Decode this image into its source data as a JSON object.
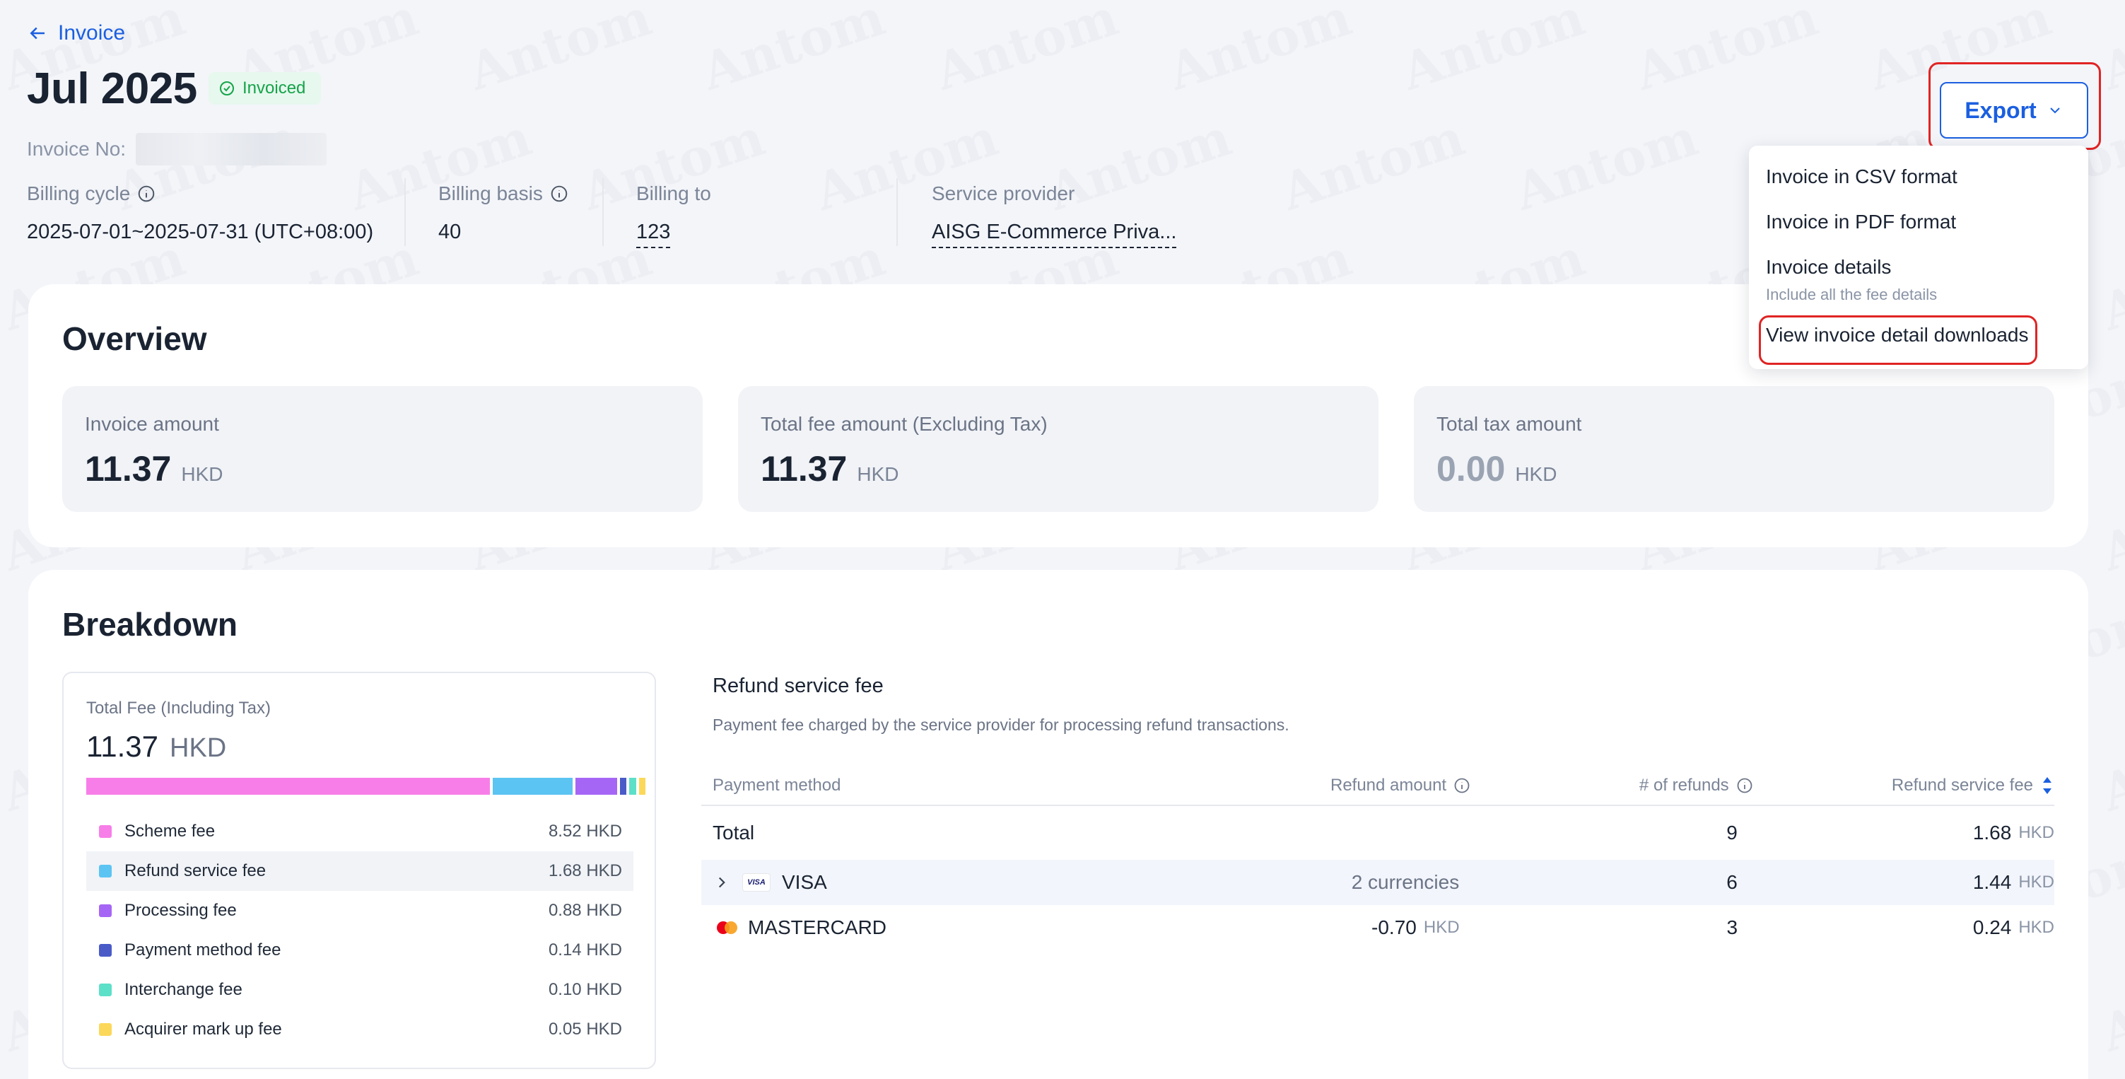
{
  "header": {
    "back_label": "Invoice",
    "title": "Jul 2025",
    "status": "Invoiced",
    "invoice_no_label": "Invoice No:"
  },
  "meta": {
    "billing_cycle_label": "Billing cycle",
    "billing_cycle_value": "2025-07-01~2025-07-31 (UTC+08:00)",
    "billing_basis_label": "Billing basis",
    "billing_basis_value": "40",
    "billing_to_label": "Billing to",
    "billing_to_value": "123",
    "service_provider_label": "Service provider",
    "service_provider_value": "AISG E-Commerce Priva..."
  },
  "export": {
    "label": "Export",
    "menu": {
      "csv": "Invoice in CSV format",
      "pdf": "Invoice in PDF format",
      "details": "Invoice details",
      "details_sub": "Include all the fee details",
      "downloads": "View invoice detail downloads"
    }
  },
  "overview": {
    "title": "Overview",
    "invoice_amount_label": "Invoice amount",
    "invoice_amount": "11.37",
    "total_fee_label": "Total fee amount (Excluding Tax)",
    "total_fee": "11.37",
    "total_tax_label": "Total tax amount",
    "total_tax": "0.00",
    "currency": "HKD"
  },
  "breakdown": {
    "title": "Breakdown",
    "total_fee_label": "Total Fee (Including Tax)",
    "total_fee_value": "11.37",
    "total_fee_currency": "HKD",
    "fees": [
      {
        "name": "Scheme fee",
        "amount": "8.52 HKD",
        "value": 8.52,
        "color": "#f77ee8"
      },
      {
        "name": "Refund service fee",
        "amount": "1.68 HKD",
        "value": 1.68,
        "color": "#5cc4f2"
      },
      {
        "name": "Processing fee",
        "amount": "0.88 HKD",
        "value": 0.88,
        "color": "#a666f5"
      },
      {
        "name": "Payment method fee",
        "amount": "0.14 HKD",
        "value": 0.14,
        "color": "#4a5bc8"
      },
      {
        "name": "Interchange fee",
        "amount": "0.10 HKD",
        "value": 0.1,
        "color": "#5de0c8"
      },
      {
        "name": "Acquirer mark up fee",
        "amount": "0.05 HKD",
        "value": 0.05,
        "color": "#fcd85a"
      }
    ]
  },
  "refund": {
    "title": "Refund service fee",
    "description": "Payment fee charged by the service provider for processing refund transactions.",
    "columns": [
      "Payment method",
      "Refund amount",
      "# of refunds",
      "Refund service fee"
    ],
    "rows": [
      {
        "method": "Total",
        "amount": "",
        "amount_unit": "",
        "count": "9",
        "fee": "1.68",
        "fee_unit": "HKD"
      },
      {
        "method": "VISA",
        "amount": "2 currencies",
        "amount_unit": "",
        "count": "6",
        "fee": "1.44",
        "fee_unit": "HKD"
      },
      {
        "method": "MASTERCARD",
        "amount": "-0.70",
        "amount_unit": "HKD",
        "count": "3",
        "fee": "0.24",
        "fee_unit": "HKD"
      }
    ]
  },
  "watermark": "Antom"
}
